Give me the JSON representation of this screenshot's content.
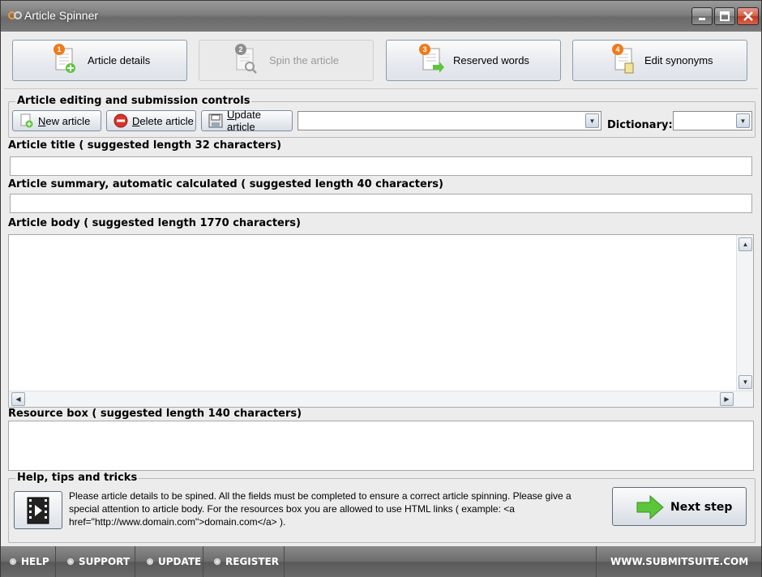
{
  "window": {
    "title": "Article Spinner"
  },
  "steps": [
    {
      "number": "1",
      "label": "Article details",
      "enabled": true
    },
    {
      "number": "2",
      "label": "Spin the article",
      "enabled": false
    },
    {
      "number": "3",
      "label": "Reserved words",
      "enabled": true
    },
    {
      "number": "4",
      "label": "Edit synonyms",
      "enabled": true
    }
  ],
  "controls": {
    "group_title": "Article editing and submission controls",
    "new_article": {
      "underline": "N",
      "rest": "ew article"
    },
    "delete_article": {
      "underline": "D",
      "rest": "elete article"
    },
    "update_article": {
      "underline": "U",
      "rest": "pdate article"
    },
    "article_select_value": "",
    "dictionary_label": "Dictionary:",
    "dictionary_value": ""
  },
  "fields": {
    "title_label": "Article title ( suggested length 32 characters)",
    "title_value": "",
    "summary_label": "Article summary, automatic calculated ( suggested length 40 characters)",
    "summary_value": "",
    "body_label": "Article body ( suggested length 1770 characters)",
    "body_value": "",
    "resource_label": "Resource box ( suggested length 140 characters)",
    "resource_value": ""
  },
  "help": {
    "group_title": "Help, tips and tricks",
    "text": "Please article details to be spined. All the fields must be completed to ensure a correct article spinning. Please give a special attention to article body. For the resources box you are allowed to use HTML links ( example: <a href=\"http://www.domain.com\">domain.com</a> ).",
    "next_step": "Next step"
  },
  "bottom_bar": {
    "help": "HELP",
    "support": "SUPPORT",
    "update": "UPDATE",
    "register": "REGISTER",
    "website": "WWW.SUBMITSUITE.COM"
  },
  "colors": {
    "badge_orange": "#f07a1a",
    "badge_gray": "#8d8d8d",
    "arrow_green": "#5cc63a",
    "close_red": "#c9432a"
  }
}
